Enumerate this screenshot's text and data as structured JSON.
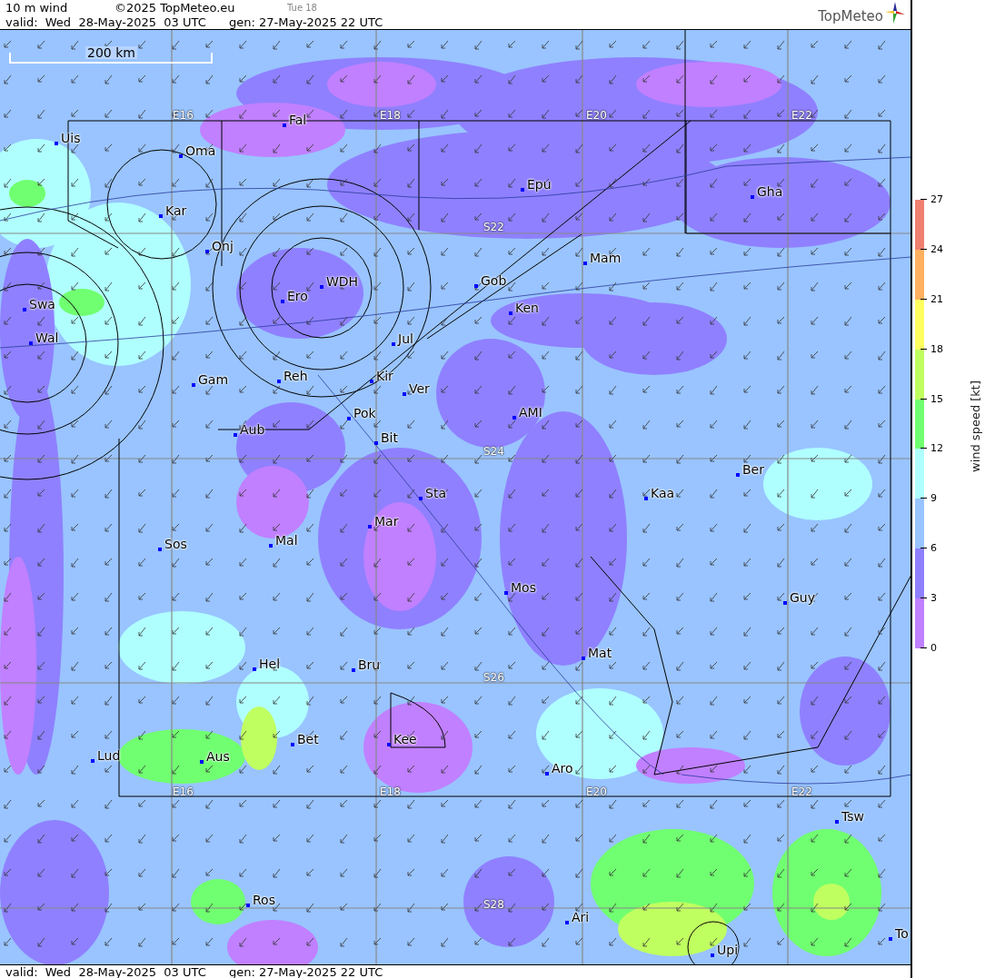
{
  "header": {
    "title": "10 m wind",
    "copyright": "©2025 TopMeteo.eu",
    "day": "Tue 18",
    "valid": "valid:  Wed  28-May-2025  03 UTC",
    "gen": "gen: 27-May-2025 22 UTC"
  },
  "logo": {
    "text": "TopMeteo"
  },
  "scale": {
    "label": "200 km"
  },
  "grid_labels": [
    {
      "text": "E16"
    },
    {
      "text": "E18"
    },
    {
      "text": "E20"
    },
    {
      "text": "E22"
    },
    {
      "text": "S22"
    },
    {
      "text": "S24"
    },
    {
      "text": "S26"
    },
    {
      "text": "E16"
    },
    {
      "text": "E18"
    },
    {
      "text": "E20"
    },
    {
      "text": "E22"
    },
    {
      "text": "S28"
    }
  ],
  "places": [
    {
      "name": "Uis"
    },
    {
      "name": "Oma"
    },
    {
      "name": "Kar"
    },
    {
      "name": "Fal"
    },
    {
      "name": "Epu"
    },
    {
      "name": "Gha"
    },
    {
      "name": "Onj"
    },
    {
      "name": "Mam"
    },
    {
      "name": "Gob"
    },
    {
      "name": "WDH"
    },
    {
      "name": "Ero"
    },
    {
      "name": "Ken"
    },
    {
      "name": "Swa"
    },
    {
      "name": "Wal"
    },
    {
      "name": "Jul"
    },
    {
      "name": "Gam"
    },
    {
      "name": "Reh"
    },
    {
      "name": "Kir"
    },
    {
      "name": "Ver"
    },
    {
      "name": "AMI"
    },
    {
      "name": "Pok"
    },
    {
      "name": "Bit"
    },
    {
      "name": "Aub"
    },
    {
      "name": "Ber"
    },
    {
      "name": "Kaa"
    },
    {
      "name": "Sta"
    },
    {
      "name": "Mar"
    },
    {
      "name": "Sos"
    },
    {
      "name": "Mal"
    },
    {
      "name": "Mos"
    },
    {
      "name": "Guy"
    },
    {
      "name": "Mat"
    },
    {
      "name": "Hel"
    },
    {
      "name": "Bru"
    },
    {
      "name": "Bet"
    },
    {
      "name": "Kee"
    },
    {
      "name": "Lud"
    },
    {
      "name": "Aus"
    },
    {
      "name": "Aro"
    },
    {
      "name": "Tsw"
    },
    {
      "name": "Ros"
    },
    {
      "name": "Ari"
    },
    {
      "name": "Upi"
    },
    {
      "name": "To"
    }
  ],
  "legend": {
    "label": "wind speed [kt]",
    "ticks": [
      "27",
      "24",
      "21",
      "18",
      "15",
      "12",
      "9",
      "6",
      "3",
      "0"
    ],
    "bands": [
      {
        "color": "#f08070"
      },
      {
        "color": "#ffb060"
      },
      {
        "color": "#ffff60"
      },
      {
        "color": "#c0ff60"
      },
      {
        "color": "#70ff70"
      },
      {
        "color": "#b0ffff"
      },
      {
        "color": "#99c4ff"
      },
      {
        "color": "#8f80ff"
      },
      {
        "color": "#c080ff"
      }
    ]
  },
  "footer": {
    "valid": "valid:  Wed  28-May-2025  03 UTC",
    "gen": "gen: 27-May-2025 22 UTC"
  }
}
